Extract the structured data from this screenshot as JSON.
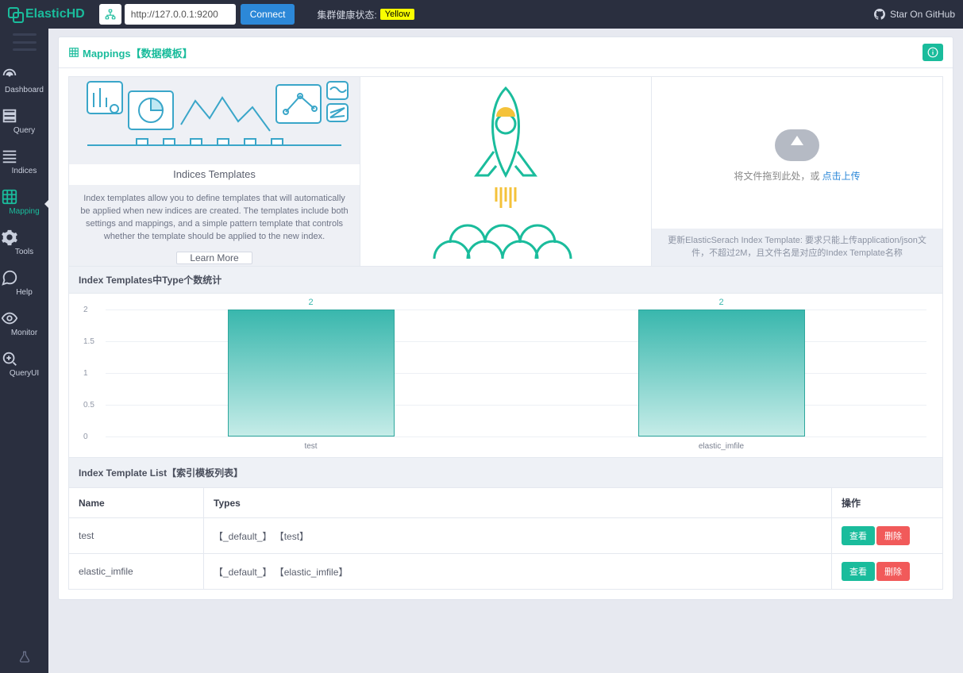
{
  "header": {
    "brand": "ElasticHD",
    "url": "http://127.0.0.1:9200",
    "connect_label": "Connect",
    "health_label": "集群健康状态:",
    "health_badge": "Yellow",
    "github_label": "Star On GitHub"
  },
  "sidebar": {
    "items": [
      {
        "label": "Dashboard"
      },
      {
        "label": "Query"
      },
      {
        "label": "Indices"
      },
      {
        "label": "Mapping"
      },
      {
        "label": "Tools"
      },
      {
        "label": "Help"
      },
      {
        "label": "Monitor"
      },
      {
        "label": "QueryUI"
      }
    ]
  },
  "page": {
    "title": "Mappings【数据模板】"
  },
  "pane1": {
    "caption": "Indices Templates",
    "desc": "Index templates allow you to define templates that will automatically be applied when new indices are created. The templates include both settings and mappings, and a simple pattern template that controls whether the template should be applied to the new index.",
    "learn": "Learn More"
  },
  "pane3": {
    "drop_text": "将文件拖到此处，或 ",
    "drop_link": "点击上传",
    "hint": "更新ElasticSerach Index Template: 要求只能上传application/json文件，不超过2M，且文件名是对应的Index Template名称"
  },
  "chart_section_title": "Index Templates中Type个数统计",
  "chart_data": {
    "type": "bar",
    "categories": [
      "test",
      "elastic_imfile"
    ],
    "values": [
      2,
      2
    ],
    "ylim": [
      0,
      2
    ],
    "yticks": [
      0,
      0.5,
      1,
      1.5,
      2
    ]
  },
  "list": {
    "title": "Index Template List【索引模板列表】",
    "columns": {
      "name": "Name",
      "types": "Types",
      "ops": "操作"
    },
    "rows": [
      {
        "name": "test",
        "types": "【_default_】 【test】"
      },
      {
        "name": "elastic_imfile",
        "types": "【_default_】 【elastic_imfile】"
      }
    ],
    "view_label": "查看",
    "delete_label": "删除"
  }
}
